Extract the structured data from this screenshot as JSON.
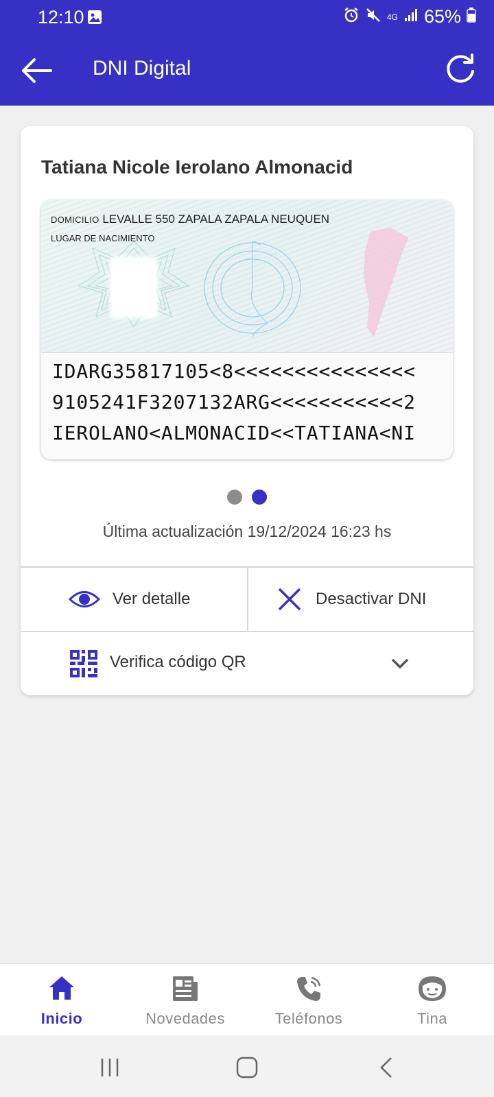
{
  "status_bar": {
    "time": "12:10",
    "network": "4G",
    "battery": "65%"
  },
  "toolbar": {
    "title": "DNI Digital"
  },
  "card": {
    "holder_name": "Tatiana Nicole Ierolano Almonacid",
    "domicilio_label": "DOMICILIO",
    "domicilio_value": "LEVALLE 550 ZAPALA ZAPALA NEUQUEN",
    "nacimiento_label": "LUGAR DE NACIMIENTO",
    "mrz": [
      "IDARG35817105<8<<<<<<<<<<<<<<<",
      "9105241F3207132ARG<<<<<<<<<<<2",
      "IEROLANO<ALMONACID<<TATIANA<NI"
    ],
    "pager": {
      "total": 2,
      "active": 2
    },
    "last_update": "Última actualización 19/12/2024 16:23 hs",
    "view_detail_label": "Ver detalle",
    "deactivate_label": "Desactivar DNI",
    "qr_label": "Verifica código QR"
  },
  "bottom_nav": {
    "items": [
      {
        "label": "Inicio",
        "icon": "home-icon",
        "active": true
      },
      {
        "label": "Novedades",
        "icon": "news-icon",
        "active": false
      },
      {
        "label": "Teléfonos",
        "icon": "phone-icon",
        "active": false
      },
      {
        "label": "Tina",
        "icon": "assistant-face-icon",
        "active": false
      }
    ]
  },
  "colors": {
    "brand": "#3730c4",
    "inactive": "#888888",
    "dot_inactive": "#8c8c8c"
  }
}
